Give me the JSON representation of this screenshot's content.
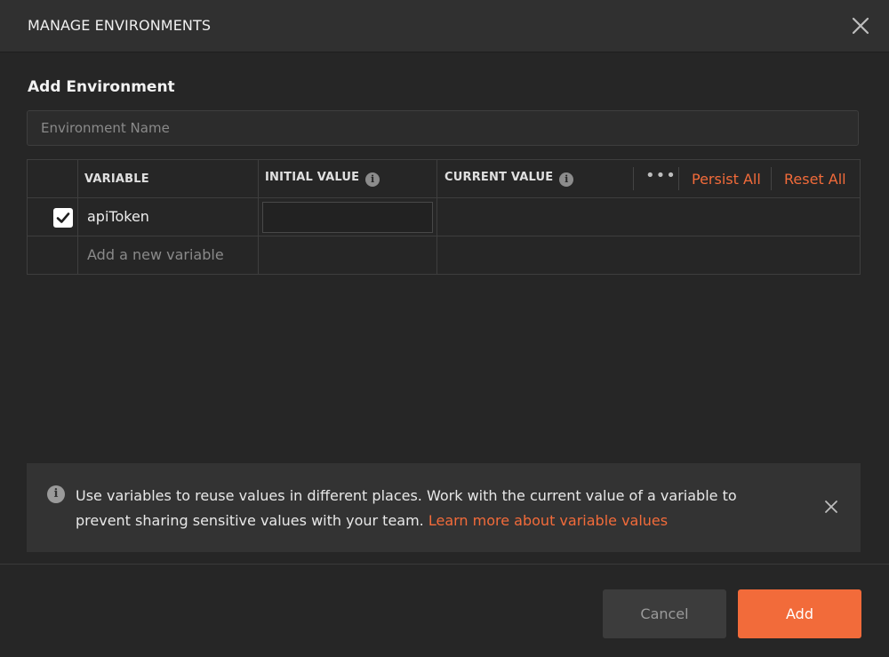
{
  "modal": {
    "title": "MANAGE ENVIRONMENTS",
    "section_title": "Add Environment",
    "env_name_placeholder": "Environment Name"
  },
  "table": {
    "headers": {
      "variable": "VARIABLE",
      "initial_value": "INITIAL VALUE",
      "current_value": "CURRENT VALUE"
    },
    "actions": {
      "more": "•••",
      "persist_all": "Persist All",
      "reset_all": "Reset All"
    },
    "rows": [
      {
        "checked": true,
        "variable": "apiToken",
        "initial_value": "",
        "current_value": ""
      }
    ],
    "new_variable_placeholder": "Add a new variable"
  },
  "info_banner": {
    "text": "Use variables to reuse values in different places. Work with the current value of a variable to prevent sharing sensitive values with your team. ",
    "link": "Learn more about variable values"
  },
  "footer": {
    "cancel_label": "Cancel",
    "add_label": "Add"
  },
  "colors": {
    "accent": "#f26b3a",
    "background": "#262626",
    "header": "#303030"
  }
}
